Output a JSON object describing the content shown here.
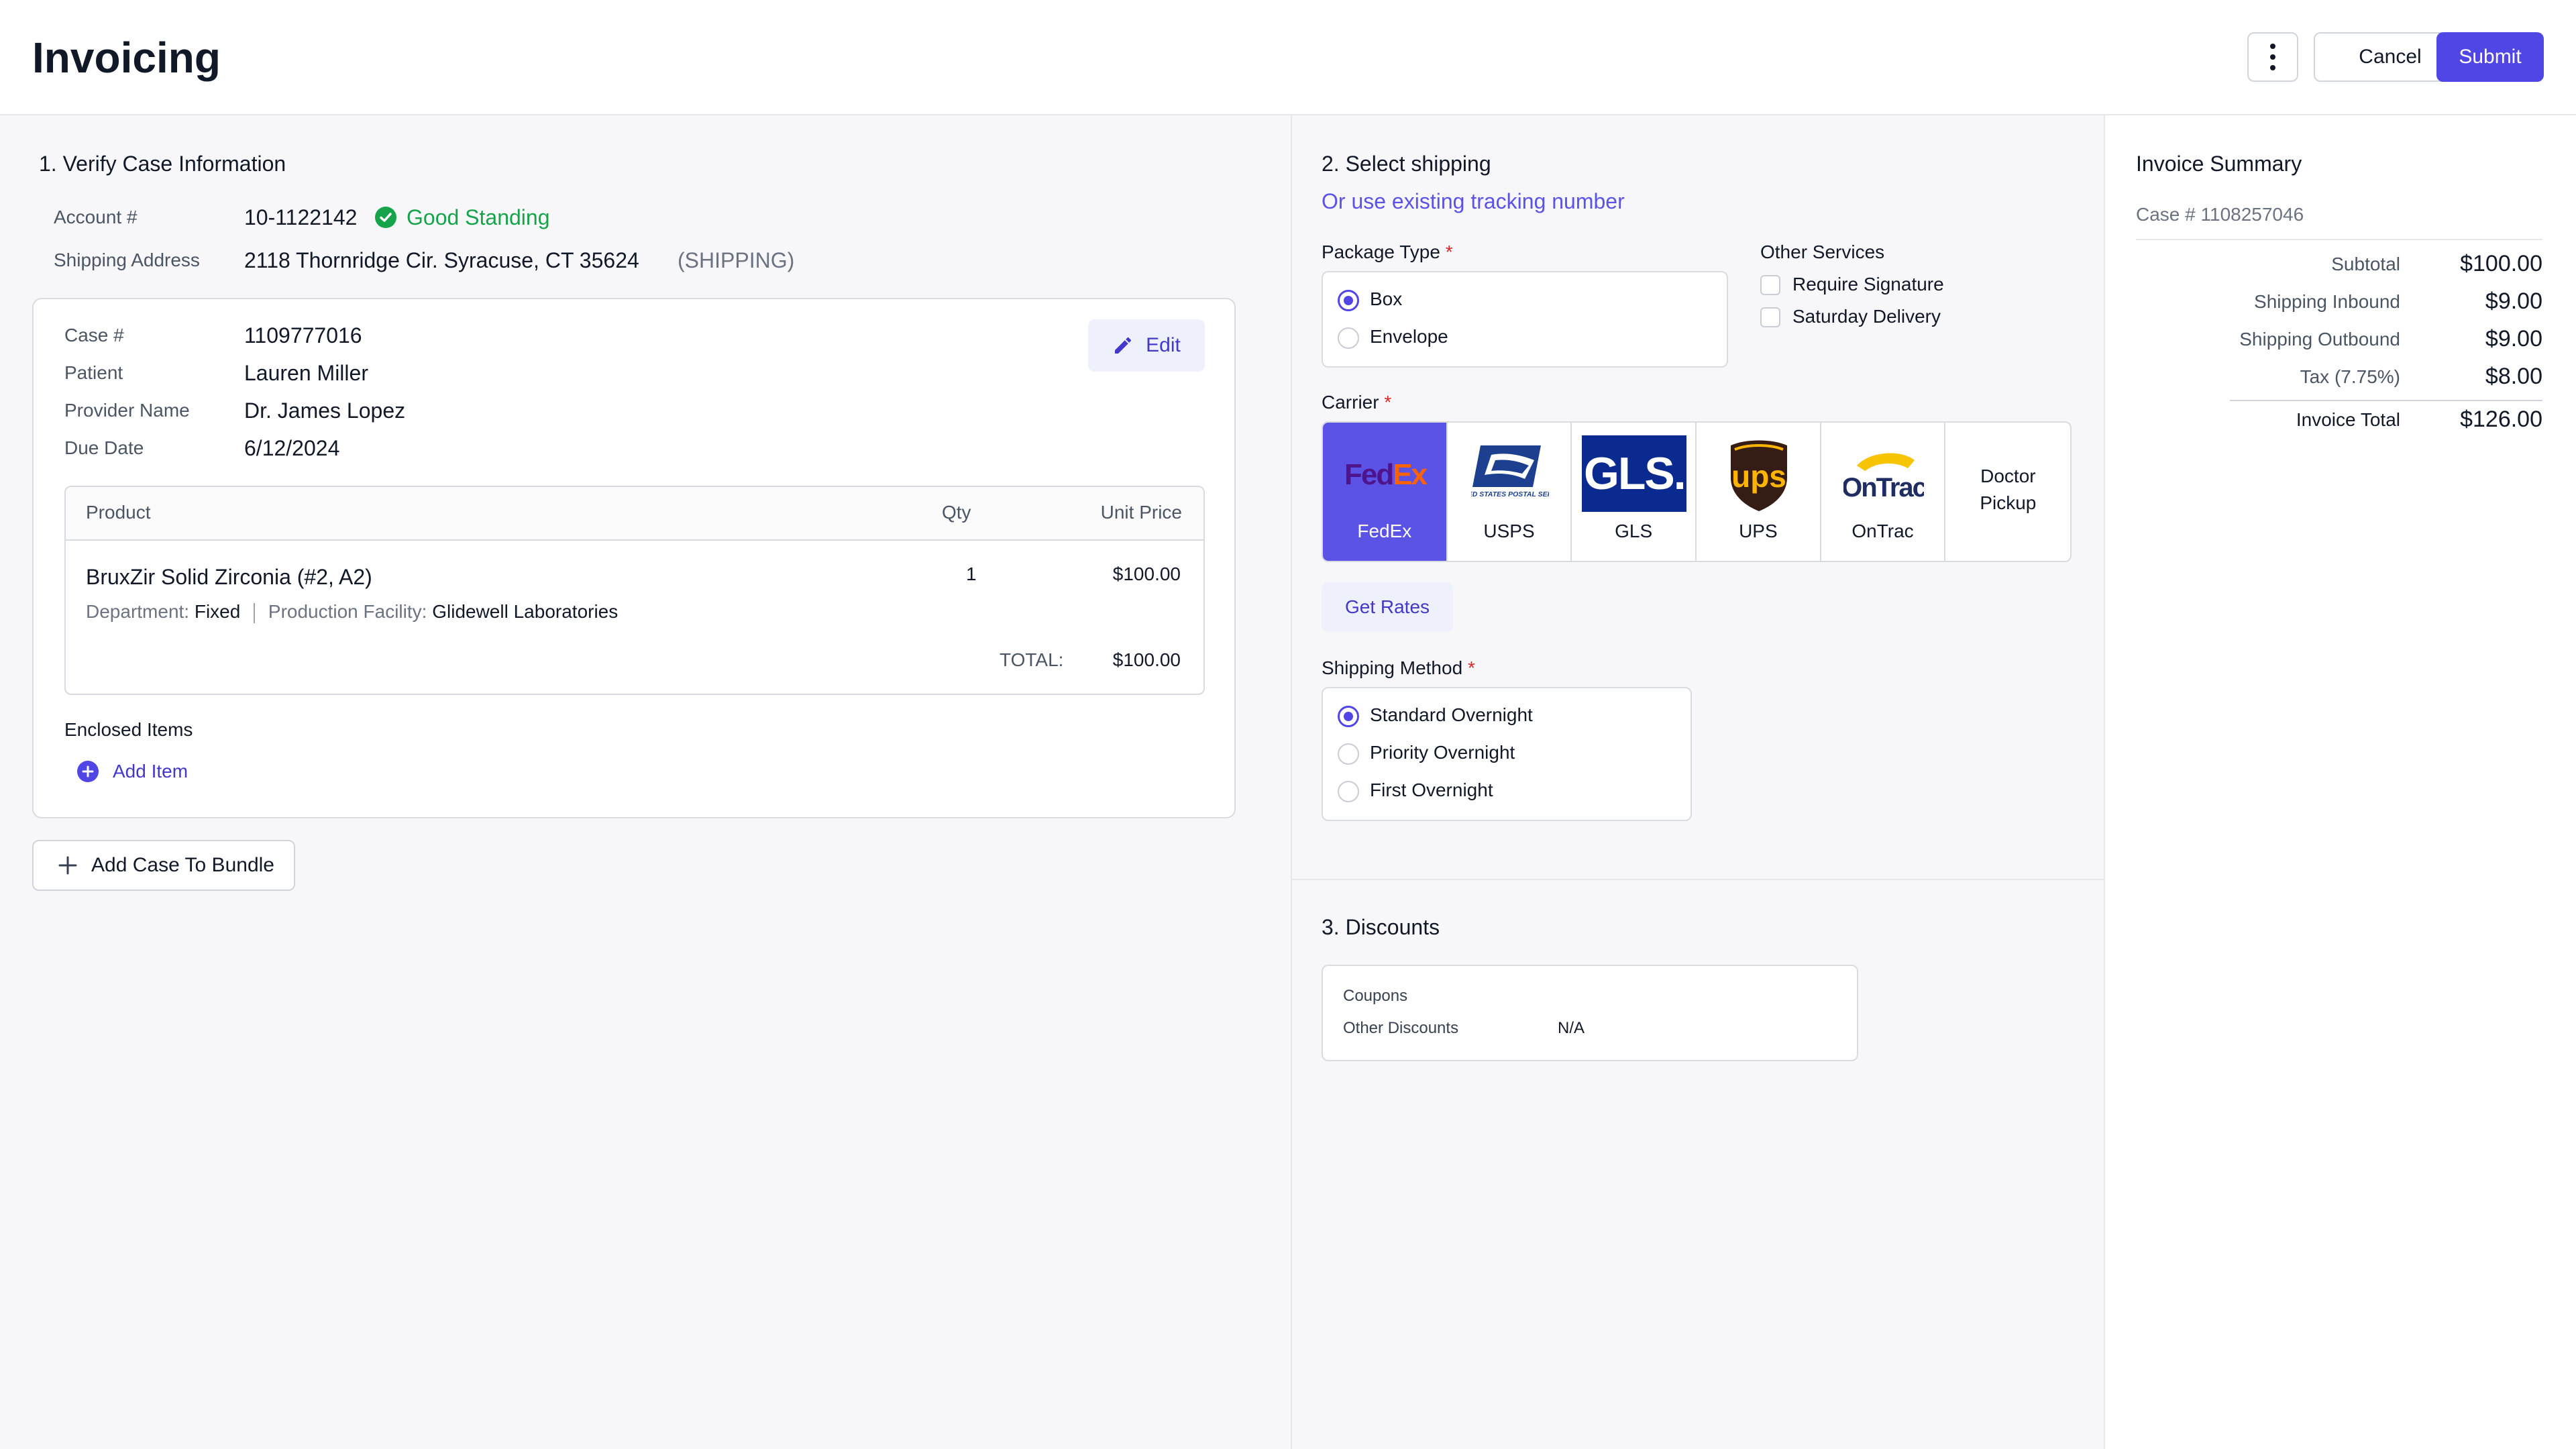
{
  "header": {
    "title": "Invoicing",
    "cancel_label": "Cancel",
    "submit_label": "Submit"
  },
  "verify": {
    "heading": "1. Verify Case Information",
    "account_label": "Account #",
    "account_value": "10-1122142",
    "standing": "Good Standing",
    "address_label": "Shipping Address",
    "address_value": "2118 Thornridge Cir. Syracuse, CT 35624",
    "address_tag": "(SHIPPING)"
  },
  "case": {
    "case_label": "Case #",
    "case_value": "1109777016",
    "patient_label": "Patient",
    "patient_value": "Lauren Miller",
    "provider_label": "Provider Name",
    "provider_value": "Dr. James Lopez",
    "due_label": "Due Date",
    "due_value": "6/12/2024",
    "edit_label": "Edit"
  },
  "products": {
    "col_product": "Product",
    "col_qty": "Qty",
    "col_price": "Unit Price",
    "item_name": "BruxZir Solid Zirconia (#2, A2)",
    "dept_label": "Department:",
    "dept_value": "Fixed",
    "facility_label": "Production Facility:",
    "facility_value": "Glidewell Laboratories",
    "qty": "1",
    "price": "$100.00",
    "total_label": "TOTAL:",
    "total_value": "$100.00"
  },
  "enclosed": {
    "heading": "Enclosed Items",
    "add_label": "Add Item"
  },
  "add_case_label": "Add Case To Bundle",
  "shipping": {
    "heading": "2. Select shipping",
    "tracking_link": "Or use existing tracking number",
    "package_label": "Package Type",
    "package_options": [
      "Box",
      "Envelope"
    ],
    "package_selected": "Box",
    "other_label": "Other Services",
    "other_options": [
      "Require Signature",
      "Saturday Delivery"
    ],
    "carrier_label": "Carrier",
    "carriers": [
      "FedEx",
      "USPS",
      "GLS",
      "UPS",
      "OnTrac",
      "Doctor Pickup"
    ],
    "carrier_selected": "FedEx",
    "logo_text": {
      "fedex_a": "Fed",
      "fedex_b": "Ex",
      "usps": "UNITED STATES POSTAL SERVICE",
      "gls": "GLS.",
      "ups": "ups",
      "ontrac": "OnTrac"
    },
    "get_rates_label": "Get Rates",
    "method_label": "Shipping Method",
    "method_options": [
      "Standard Overnight",
      "Priority Overnight",
      "First Overnight"
    ],
    "method_selected": "Standard Overnight",
    "required_mark": "*"
  },
  "discounts": {
    "heading": "3. Discounts",
    "coupons_label": "Coupons",
    "other_label": "Other Discounts",
    "other_value": "N/A"
  },
  "summary": {
    "heading": "Invoice Summary",
    "case_ref": "Case # 1108257046",
    "rows": [
      {
        "label": "Subtotal",
        "value": "$100.00"
      },
      {
        "label": "Shipping Inbound",
        "value": "$9.00"
      },
      {
        "label": "Shipping Outbound",
        "value": "$9.00"
      },
      {
        "label": "Tax (7.75%)",
        "value": "$8.00"
      }
    ],
    "total_label": "Invoice Total",
    "total_value": "$126.00"
  },
  "colors": {
    "accent": "#5046e5",
    "success": "#16a34a",
    "link": "#5b52e6",
    "required": "#dc2626"
  }
}
